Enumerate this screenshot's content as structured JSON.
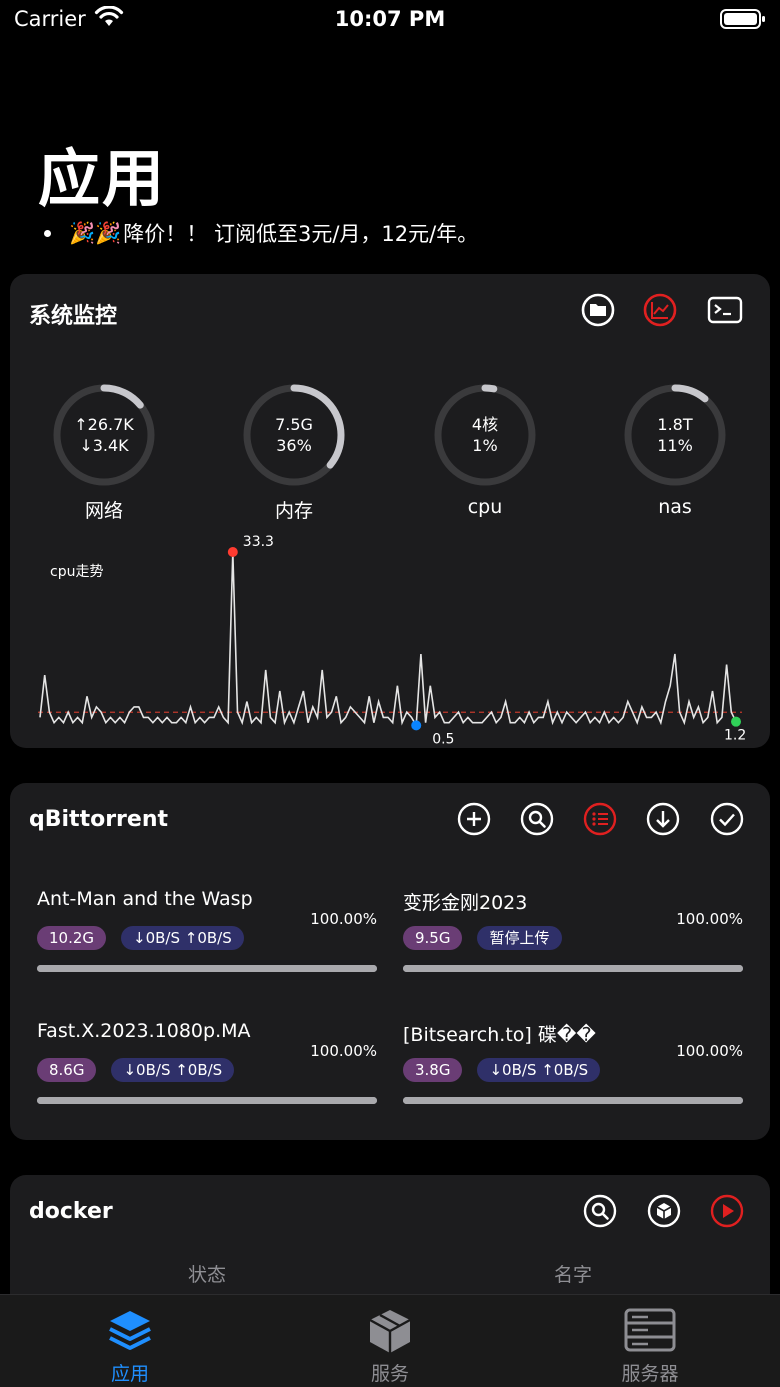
{
  "status_bar": {
    "carrier": "Carrier",
    "time": "10:07 PM"
  },
  "page": {
    "title": "应用",
    "notice_emoji": "🎉🎉",
    "notice": "降价！！ 订阅低至3元/月，12元/年。"
  },
  "monitor": {
    "title": "系统监控",
    "icons": [
      "folder-icon",
      "chart-icon",
      "terminal-icon"
    ],
    "gauges": [
      {
        "line1": "↑26.7K",
        "line2": "↓3.4K",
        "label": "网络",
        "fraction": 0.14
      },
      {
        "line1": "7.5G",
        "line2": "36%",
        "label": "内存",
        "fraction": 0.36
      },
      {
        "line1": "4核",
        "line2": "1%",
        "label": "cpu",
        "fraction": 0.03
      },
      {
        "line1": "1.8T",
        "line2": "11%",
        "label": "nas",
        "fraction": 0.11
      }
    ],
    "trend": {
      "title": "cpu走势",
      "max_label": "33.3",
      "min_label": "0.5",
      "last_label": "1.2"
    }
  },
  "chart_data": {
    "type": "line",
    "title": "cpu走势",
    "series": [
      {
        "values": [
          2,
          10,
          3,
          1,
          2,
          1,
          3,
          1,
          2,
          1,
          6,
          2,
          4,
          3,
          1,
          2,
          1,
          2,
          1,
          3,
          4,
          4,
          2,
          2,
          1,
          2,
          1,
          2,
          1,
          1,
          2,
          1,
          4,
          1,
          2,
          1,
          2,
          2,
          4,
          2,
          1,
          33.3,
          3,
          1,
          5,
          1,
          2,
          1,
          11,
          2,
          1,
          7,
          1,
          3,
          1,
          4,
          7,
          1,
          4,
          2,
          11,
          2,
          3,
          6,
          1,
          2,
          4,
          3,
          2,
          1,
          6,
          1,
          5,
          2,
          2,
          1,
          8,
          1,
          3,
          2,
          0.5,
          14,
          1,
          8,
          2,
          3,
          1,
          1,
          2,
          3,
          1,
          2,
          1,
          1,
          1,
          2,
          3,
          1,
          2,
          5,
          1,
          1,
          2,
          1,
          3,
          1,
          2,
          2,
          5,
          1,
          3,
          1,
          3,
          2,
          1,
          2,
          3,
          1,
          2,
          1,
          3,
          1,
          2,
          1,
          2,
          5,
          3,
          1,
          4,
          2,
          2,
          3,
          1,
          5,
          8,
          14,
          3,
          1,
          5,
          2,
          4,
          1,
          2,
          7,
          1,
          2,
          12,
          3,
          1.2
        ]
      }
    ],
    "annotations": {
      "max": 33.3,
      "min": 0.5,
      "last": 1.2
    },
    "average_line": true,
    "colors": {
      "line": "#e5e5e5",
      "max": "#ff3b30",
      "min": "#0a84ff",
      "last": "#30d158",
      "average": "#c0392b"
    }
  },
  "qbit": {
    "title": "qBittorrent",
    "icons": [
      "add-icon",
      "search-icon",
      "list-icon",
      "download-icon",
      "check-icon"
    ],
    "torrents": [
      {
        "name": "Ant-Man and the Wasp",
        "percent": "100.00%",
        "size": "10.2G",
        "status": "↓0B/S ↑0B/S",
        "progress": 1.0
      },
      {
        "name": "变形金刚2023",
        "percent": "100.00%",
        "size": "9.5G",
        "status": "暂停上传",
        "progress": 1.0
      },
      {
        "name": "Fast.X.2023.1080p.MA",
        "percent": "100.00%",
        "size": "8.6G",
        "status": "↓0B/S ↑0B/S",
        "progress": 1.0
      },
      {
        "name": "[Bitsearch.to] 碟��",
        "percent": "100.00%",
        "size": "3.8G",
        "status": "↓0B/S ↑0B/S",
        "progress": 1.0
      }
    ]
  },
  "docker": {
    "title": "docker",
    "icons": [
      "search-icon",
      "cube-icon",
      "play-icon"
    ],
    "columns": [
      "状态",
      "名字"
    ]
  },
  "tabbar": {
    "tabs": [
      {
        "label": "应用",
        "icon": "layers-icon",
        "active": true
      },
      {
        "label": "服务",
        "icon": "box-icon",
        "active": false
      },
      {
        "label": "服务器",
        "icon": "server-icon",
        "active": false
      }
    ],
    "active_color": "#1f8fff",
    "inactive_color": "#8e8e93"
  }
}
